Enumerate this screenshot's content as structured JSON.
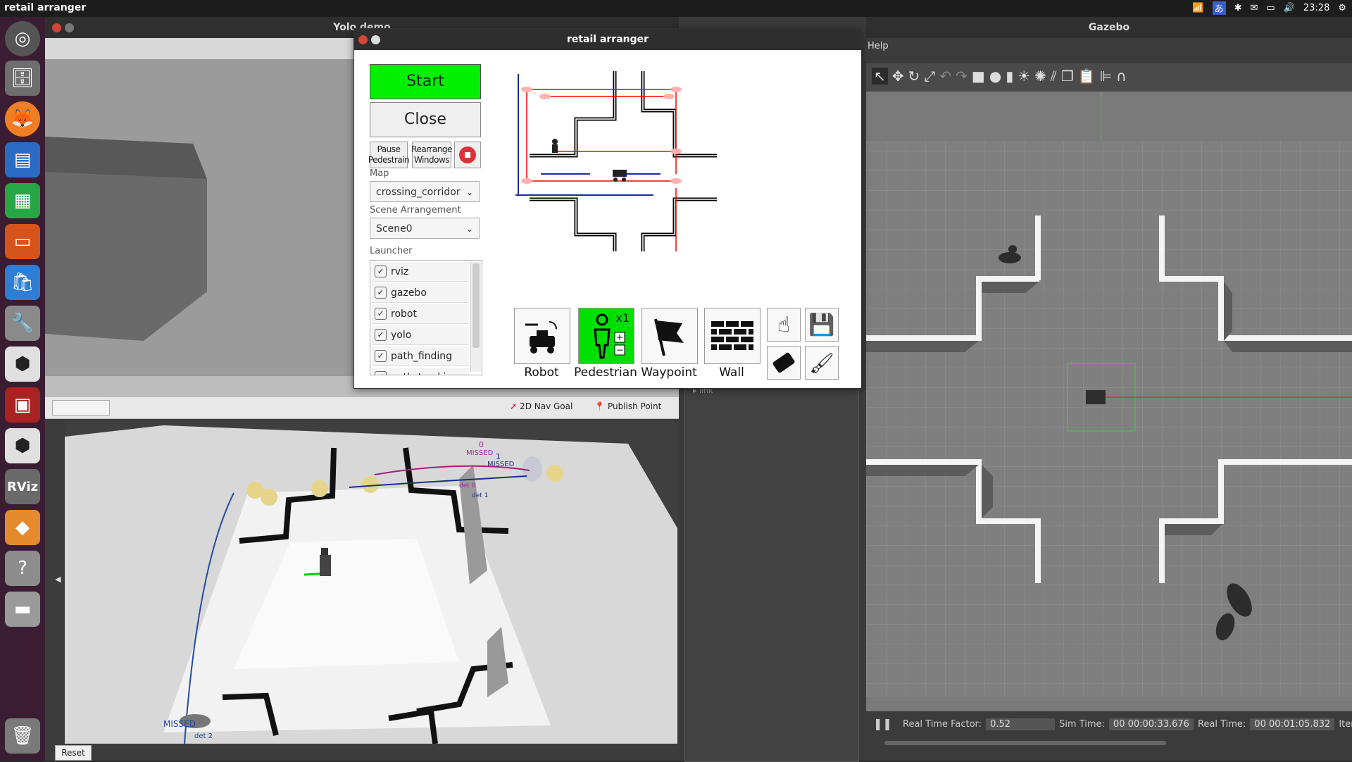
{
  "topbar": {
    "app_title": "retail arranger",
    "clock": "23:28"
  },
  "windows": {
    "yolo_title": "Yolo demo",
    "gazebo_title": "Gazebo",
    "arranger_title": "retail arranger"
  },
  "arranger": {
    "start_label": "Start",
    "close_label": "Close",
    "pause_label": "Pause Pedestrain",
    "rearrange_label": "Rearrange Windows",
    "map_label": "Map",
    "map_value": "crossing_corridor",
    "scene_label": "Scene Arrangement",
    "scene_value": "Scene0",
    "launcher_label": "Launcher",
    "launcher_items": [
      "rviz",
      "gazebo",
      "robot",
      "yolo",
      "path_finding",
      "path_tracking"
    ],
    "tools": {
      "robot": "Robot",
      "pedestrian": "Pedestrian",
      "pedestrian_count": "x1",
      "waypoint": "Waypoint",
      "wall": "Wall"
    },
    "accent_start": "#00f000",
    "accent_pedestrian": "#00e000",
    "route_color": "#ff0000"
  },
  "rviz": {
    "nav_goal": "2D Nav Goal",
    "publish_point": "Publish Point",
    "reset": "Reset",
    "labels": {
      "m0": "MISSED",
      "n0": "0",
      "m1": "MISSED",
      "n1": "1",
      "d0": "det 0",
      "d1": "det 1",
      "m2": "MISSED",
      "d2": "det 2"
    }
  },
  "gazebo": {
    "help_menu": "Help",
    "rtf_label": "Real Time Factor:",
    "rtf_value": "0.52",
    "sim_label": "Sim Time:",
    "sim_value": "00 00:00:33.676",
    "real_label": "Real Time:",
    "real_value": "00 00:01:05.832",
    "iter_label": "Iteratio"
  },
  "midpanel": {
    "link_label": "link"
  }
}
